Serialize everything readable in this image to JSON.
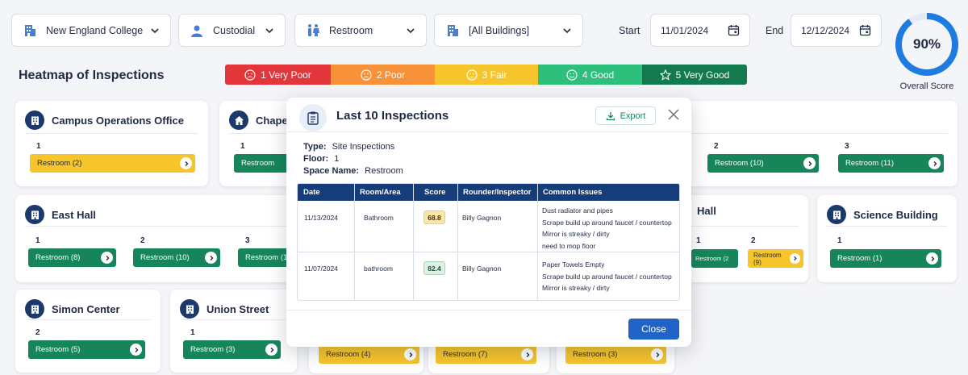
{
  "filters": {
    "campus": "New England College",
    "department": "Custodial",
    "space_type": "Restroom",
    "buildings": "[All Buildings]",
    "start_label": "Start",
    "start_date": "11/01/2024",
    "end_label": "End",
    "end_date": "12/12/2024"
  },
  "score": {
    "value": "90%",
    "fraction": 0.9,
    "label": "Overall Score"
  },
  "heatmap_title": "Heatmap of Inspections",
  "legend": [
    {
      "label": "1 Very Poor",
      "color": "#e3363a"
    },
    {
      "label": "2 Poor",
      "color": "#f7923b"
    },
    {
      "label": "3 Fair",
      "color": "#f6c52c"
    },
    {
      "label": "4 Good",
      "color": "#2fbf7c"
    },
    {
      "label": "5 Very Good",
      "color": "#137a4f"
    }
  ],
  "cards": {
    "campus_ops": {
      "name": "Campus Operations Office",
      "floor": "1",
      "item": "Restroom (2)"
    },
    "chapel": {
      "name": "Chape",
      "floor": "1",
      "item": "Restroom"
    },
    "hidden_right": {
      "floors": [
        "2",
        "3"
      ],
      "items": [
        "Restroom (10)",
        "Restroom (11)"
      ]
    },
    "east_hall": {
      "name": "East Hall",
      "floors": [
        "1",
        "2",
        "3"
      ],
      "items": [
        "Restroom (8)",
        "Restroom (10)",
        "Restroom (1"
      ]
    },
    "hall": {
      "name": "Hall",
      "floors": [
        "1",
        "2"
      ],
      "items": [
        "Restroom (2",
        "Restroom (9)"
      ]
    },
    "science": {
      "name": "Science Building",
      "floor": "1",
      "item": "Restroom (1)"
    },
    "simon": {
      "name": "Simon Center",
      "floor": "2",
      "item": "Restroom (5)"
    },
    "union": {
      "name": "Union Street",
      "floor": "1",
      "item": "Restroom (3)"
    },
    "bottom_items": [
      "Restroom (4)",
      "Restroom (7)",
      "Restroom (3)"
    ]
  },
  "modal": {
    "title": "Last 10 Inspections",
    "export": "Export",
    "type_label": "Type:",
    "type_value": "Site Inspections",
    "floor_label": "Floor:",
    "floor_value": "1",
    "space_label": "Space Name:",
    "space_value": "Restroom",
    "columns": [
      "Date",
      "Room/Area",
      "Score",
      "Rounder/Inspector",
      "Common Issues"
    ],
    "rows": [
      {
        "date": "11/13/2024",
        "room": "Bathroom",
        "score": "68.8",
        "inspector": "Billy Gagnon",
        "issues": [
          "Dust radiator and pipes",
          "Scrape build up around faucet / countertop",
          "Mirror is streaky / dirty",
          "need to mop floor"
        ]
      },
      {
        "date": "11/07/2024",
        "room": "bathroom",
        "score": "82.4",
        "inspector": "Billy Gagnon",
        "issues": [
          "Paper Towels Empty",
          "Scrape build up around faucet / countertop",
          "Mirror is streaky / dirty"
        ]
      }
    ],
    "close": "Close"
  }
}
